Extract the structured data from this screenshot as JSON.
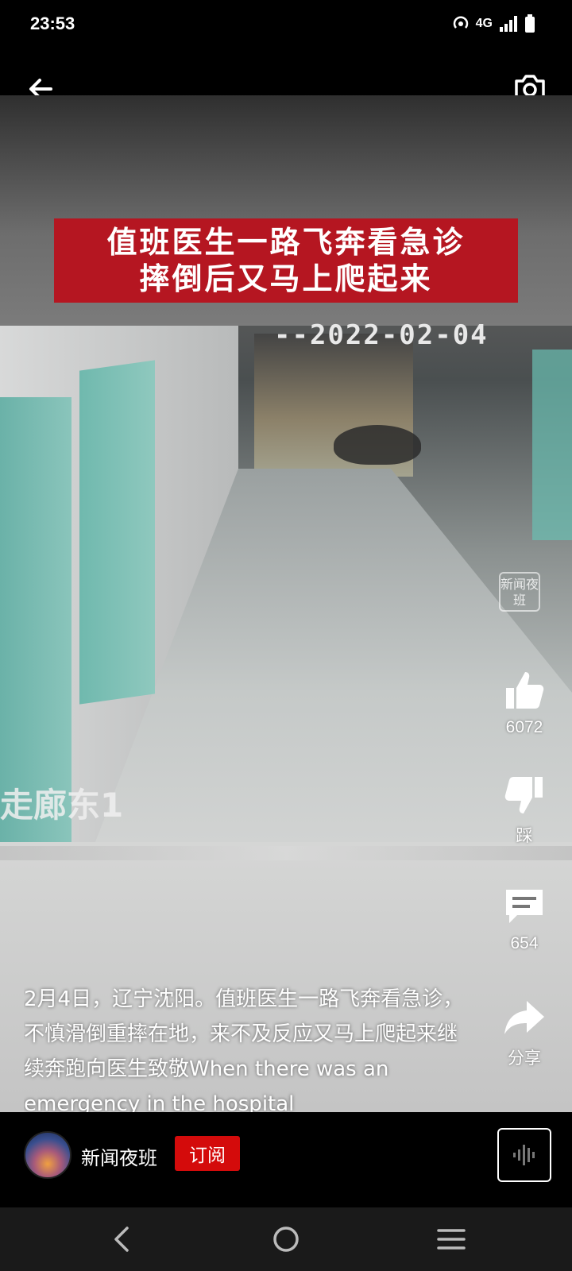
{
  "status_bar": {
    "time": "23:53",
    "network": "4G",
    "icons": [
      "hotspot-icon",
      "signal-icon",
      "battery-icon"
    ]
  },
  "top_bar": {
    "icons": [
      "back-arrow-icon",
      "camera-icon"
    ]
  },
  "video": {
    "banner_line1": "值班医生一路飞奔看急诊",
    "banner_line2": "摔倒后又马上爬起来",
    "timestamp": "--2022-02-04",
    "camera_label": "走廊东1",
    "watermark": "新闻夜班"
  },
  "actions": {
    "like_count": "6072",
    "dislike_label": "踩",
    "comment_count": "654",
    "share_label": "分享"
  },
  "description": "2月4日，辽宁沈阳。值班医生一路飞奔看急诊，不慎滑倒重摔在地，来不及反应又马上爬起来继续奔跑向医生致敬When there was an emergency in the hospital",
  "channel": {
    "name": "新闻夜班",
    "subscribe_label": "订阅"
  },
  "nav_bar": {
    "icons": [
      "nav-back-icon",
      "nav-home-icon",
      "nav-menu-icon"
    ]
  },
  "colors": {
    "banner_red": "#b51621",
    "subscribe_red": "#d40b0b"
  }
}
